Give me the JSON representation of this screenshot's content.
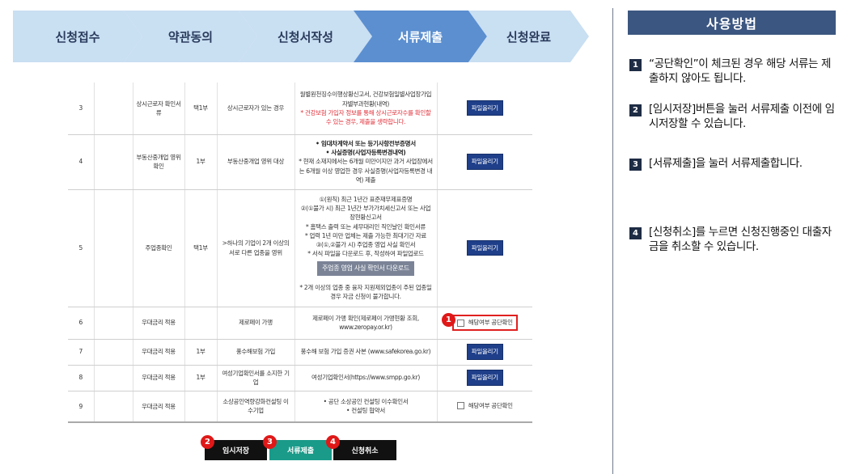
{
  "steps": [
    {
      "label": "신청접수",
      "active": false
    },
    {
      "label": "약관동의",
      "active": false
    },
    {
      "label": "신청서작성",
      "active": false
    },
    {
      "label": "서류제출",
      "active": true
    },
    {
      "label": "신청완료",
      "active": false
    }
  ],
  "colors": {
    "step_inactive": "#c9dff2",
    "step_active": "#5b8fd0",
    "help_title_bg": "#3b5680",
    "upload_button": "#1f3f8a",
    "badge": "#e01818",
    "submit_button": "#1a9b8a"
  },
  "table": {
    "upload_label": "파일올리기",
    "rows": [
      {
        "no": "3",
        "item": "상시근로자 확인서류",
        "copies": "택1부",
        "target": "상시근로자가 있는 경우",
        "docs": "월별원천징수이행상황신고서, 건강보험일별사업장가입자별부과현황(내역)",
        "note": "* 건강보험 가입자 정보를 통해 상시근로자수를 확인할 수 있는 경우, 제출을 생략합니다."
      },
      {
        "no": "4",
        "item": "부동산중개업 영위 확인",
        "copies": "1부",
        "target": "부동산중개업 영위 대상",
        "docs_bold_1": "• 임대차계약서 또는 등기사항전부증명서",
        "docs_bold_2": "• 사실증명(사업자등록변경내역)",
        "docs": "* 현재 소재지에서는 6개월 미만이지만 과거 사업장에서는 6개월 이상 영업한 경우 사실증명(사업자등록변경 내역) 제출"
      },
      {
        "no": "5",
        "item": "주업종확인",
        "copies": "택1부",
        "target": ">하나의 기업이 2개 이상의 서로 다른 업종을 영위",
        "docs_1": "①(원칙) 최근 1년간 표준재무제표증명",
        "docs_2": "②(①불가 시) 최근 1년간 부가가치세신고서 또는 사업장현황신고서",
        "docs_3": "* 홈택스 출력 또는 세무대리인 직인날인 확인서류",
        "docs_4": "* 업력 1년 미만 업체는 제출 가능한 최대기간 자료",
        "docs_5": "③(①,②불가 시) 주업종 영업 사실 확인서",
        "docs_6": "* 서식 파일을 다운로드 후, 작성하여 파일업로드",
        "download_label": "주업종 영업 사실 확인서 다운로드",
        "note": "* 2개 이상의 업종 중 융자 지원제외업종이 주된 업종일 경우 자금 신청이 불가합니다."
      },
      {
        "no": "6",
        "item": "우대금리 적용",
        "copies": "",
        "target": "제로페이 가맹",
        "docs": "제로페이 가맹 확인(제로페이 가맹현황 조회, www.zeropay.or.kr)",
        "check_label": "해당여부 공단확인"
      },
      {
        "no": "7",
        "item": "우대금리 적용",
        "copies": "1부",
        "target": "풍수해보험 가입",
        "docs": "풍수해 보험 가입 증권 사본 (www.safekorea.go.kr)"
      },
      {
        "no": "8",
        "item": "우대금리 적용",
        "copies": "1부",
        "target": "여성기업확인서를 소지한 기업",
        "docs": "여성기업확인서(https://www.smpp.go.kr)"
      },
      {
        "no": "9",
        "item": "우대금리 적용",
        "copies": "",
        "target": "소상공인역량강화컨설팅 이수기업",
        "docs_1": "• 공단 소상공인 컨설팅 이수확인서",
        "docs_2": "• 컨설팅 협약서",
        "check_label": "해당여부 공단확인"
      }
    ]
  },
  "badges": [
    "1",
    "2",
    "3",
    "4"
  ],
  "buttons": {
    "save": "임시저장",
    "submit": "서류제출",
    "cancel": "신청취소"
  },
  "help": {
    "title": "사용방법",
    "items": [
      {
        "num": "1",
        "text": "“공단확인”이 체크된 경우 해당 서류는 제출하지 않아도 됩니다."
      },
      {
        "num": "2",
        "text": "[임시저장]버튼을 눌러 서류제출 이전에 임시저장할 수 있습니다."
      },
      {
        "num": "3",
        "text": "[서류제출]을 눌러 서류제출합니다."
      },
      {
        "num": "4",
        "text": "[신청취소]를 누르면 신청진행중인 대출자금을 취소할 수 있습니다."
      }
    ]
  }
}
